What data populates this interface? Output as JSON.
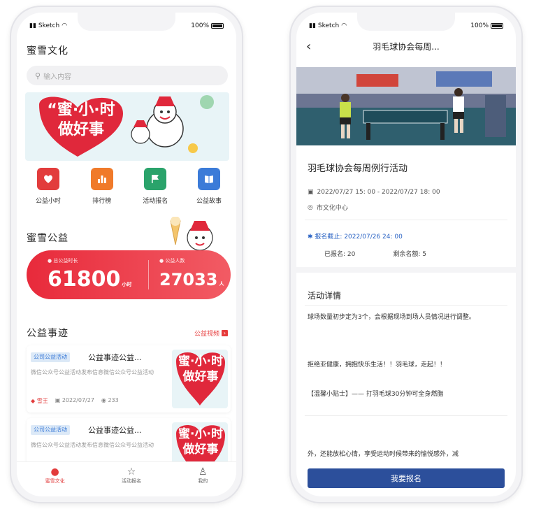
{
  "status": {
    "carrier": "Sketch",
    "battery_left": "100%",
    "battery_right": "100%"
  },
  "left": {
    "app_title": "蜜雪文化",
    "search": {
      "placeholder": "输入内容"
    },
    "banner": {
      "line1": "“蜜·小·时",
      "line2": "做好事"
    },
    "quick": [
      {
        "label": "公益小时",
        "color": "#e23c3c",
        "icon": "heart-icon"
      },
      {
        "label": "排行榜",
        "color": "#f07a2a",
        "icon": "bar-chart-icon"
      },
      {
        "label": "活动报名",
        "color": "#2aa36b",
        "icon": "flag-icon"
      },
      {
        "label": "公益故事",
        "color": "#3b7bd8",
        "icon": "book-icon"
      }
    ],
    "section1": "蜜雪公益",
    "stats": {
      "hours_label": "总公益时长",
      "hours_value": "61800",
      "hours_unit": "小时",
      "people_label": "公益人数",
      "people_value": "27033",
      "people_unit": "人"
    },
    "section2": "公益事迹",
    "more": "公益视频",
    "cards": [
      {
        "tag": "公司公益活动",
        "title": "公益事迹公益...",
        "desc": "微信公众号公益活动发布信息微信公众号公益活动",
        "author": "雪王",
        "date": "2022/07/27",
        "views": "233",
        "thumb1": "蜜·小·时",
        "thumb2": "做好事"
      },
      {
        "tag": "公司公益活动",
        "title": "公益事迹公益...",
        "desc": "微信公众号公益活动发布信息微信公众号公益活动",
        "thumb1": "蜜·小·时",
        "thumb2": "做好事"
      }
    ],
    "tabs": [
      {
        "label": "蜜雪文化",
        "icon": "home-icon"
      },
      {
        "label": "活动报名",
        "icon": "star-icon"
      },
      {
        "label": "我的",
        "icon": "user-icon"
      }
    ]
  },
  "right": {
    "nav_title": "羽毛球协会每周...",
    "event_title": "羽毛球协会每周例行活动",
    "time": "2022/07/27 15: 00 - 2022/07/27 18: 00",
    "place": "市文化中心",
    "deadline": "报名截止: 2022/07/26 24: 00",
    "signed": "已报名: 20",
    "remaining": "剩余名额: 5",
    "detail_heading": "活动详情",
    "p1": "球场数量初步定为3个，会根据现场到场人员情况进行调整。",
    "p2": "拒绝亚健康，拥抱快乐生活！！羽毛球，走起！！",
    "p3": "【温馨小贴士】—— 打羽毛球30分钟可全身燃脂",
    "p4": "外，还能放松心情，享受运动时候带来的愉悦感外，减",
    "cta": "我要报名"
  }
}
